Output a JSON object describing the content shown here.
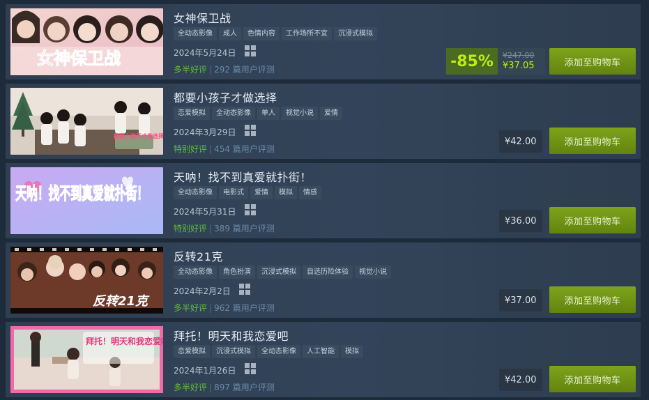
{
  "colors": {
    "positive_review": "#5fbd3c",
    "discount_text": "#beee11",
    "cart_button": "#6e9317"
  },
  "icons": {
    "platform": "windows-icon"
  },
  "games": [
    {
      "title": "女神保卫战",
      "cover_text": "女神保卫战",
      "tags": [
        "全动态影像",
        "成人",
        "色情内容",
        "工作场所不宜",
        "沉浸式模拟"
      ],
      "date": "2024年5月24日",
      "review_label": "多半好评",
      "review_count": "292 篇用户评测",
      "discount": "-85%",
      "original_price": "¥247.00",
      "price": "¥37.05",
      "cart_label": "添加至购物车"
    },
    {
      "title": "都要小孩子才做选择",
      "cover_text": "都要小孩子才做选择",
      "tags": [
        "恋爱模拟",
        "全动态影像",
        "单人",
        "视觉小说",
        "爱情"
      ],
      "date": "2024年3月29日",
      "review_label": "特别好评",
      "review_count": "454 篇用户评测",
      "price": "¥42.00",
      "cart_label": "添加至购物车"
    },
    {
      "title": "天呐！找不到真爱就扑街！",
      "cover_text": "天呐！找不到真爱就扑街！",
      "tags": [
        "全动态影像",
        "电影式",
        "爱情",
        "模拟",
        "情感"
      ],
      "date": "2024年5月31日",
      "review_label": "特别好评",
      "review_count": "389 篇用户评测",
      "price": "¥36.00",
      "cart_label": "添加至购物车"
    },
    {
      "title": "反转21克",
      "cover_text": "反转21克",
      "tags": [
        "全动态影像",
        "角色扮演",
        "沉浸式模拟",
        "自选历险体验",
        "视觉小说"
      ],
      "date": "2024年2月2日",
      "review_label": "多半好评",
      "review_count": "962 篇用户评测",
      "price": "¥37.00",
      "cart_label": "添加至购物车"
    },
    {
      "title": "拜托！明天和我恋爱吧",
      "cover_text": "拜托！明天和我恋爱吧",
      "tags": [
        "恋爱模拟",
        "沉浸式模拟",
        "全动态影像",
        "人工智能",
        "模拟"
      ],
      "date": "2024年1月26日",
      "review_label": "多半好评",
      "review_count": "897 篇用户评测",
      "price": "¥42.00",
      "cart_label": "添加至购物车"
    }
  ]
}
